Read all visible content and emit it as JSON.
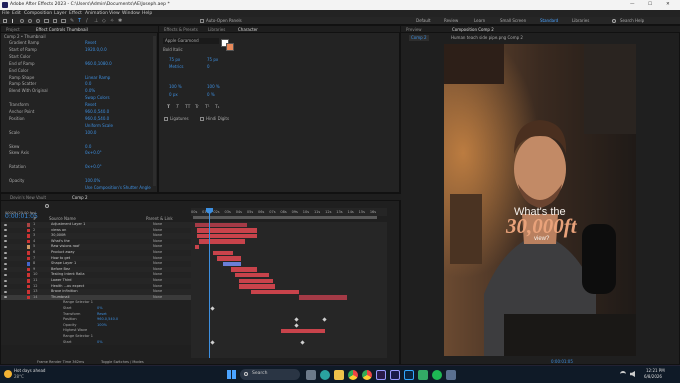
{
  "window": {
    "title": "Adobe After Effects 2023 - C:\\Users\\Admin\\Documents\\AE\\Joseph.aep *",
    "minimize": "—",
    "maximize": "☐",
    "close": "✕"
  },
  "menu": [
    "File",
    "Edit",
    "Composition",
    "Layer",
    "Effect",
    "Animation",
    "View",
    "Window",
    "Help"
  ],
  "toolbar": {
    "snapping": "Auto-Open Panels",
    "workspaces": [
      "Default",
      "Review",
      "Learn",
      "Small Screen",
      "Standard",
      "Libraries"
    ],
    "active_workspace": "Standard",
    "search": "Search Help"
  },
  "effect_controls": {
    "tabs": [
      "Project",
      "Effect Controls  Thumbnail"
    ],
    "header": "Comp 2 • Thumbnail",
    "rows": [
      {
        "name": "Gradient Ramp",
        "value": "Reset"
      },
      {
        "name": "Start of Ramp",
        "value": "1920.0,0.0"
      },
      {
        "name": "Start Color",
        "value": ""
      },
      {
        "name": "End of Ramp",
        "value": "960.0,1080.0"
      },
      {
        "name": "End Color",
        "value": ""
      },
      {
        "name": "Ramp Shape",
        "value": "Linear Ramp"
      },
      {
        "name": "Ramp Scatter",
        "value": "0.0"
      },
      {
        "name": "Blend With Original",
        "value": "0.0%"
      },
      {
        "name": "",
        "value": "Swap Colors"
      },
      {
        "name": "Transform",
        "value": "Reset"
      },
      {
        "name": "Anchor Point",
        "value": "960.0,540.0"
      },
      {
        "name": "Position",
        "value": "960.0,540.0"
      },
      {
        "name": "",
        "value": "Uniform Scale"
      },
      {
        "name": "Scale",
        "value": "100.0"
      },
      {
        "name": "",
        "value": ""
      },
      {
        "name": "Skew",
        "value": "0.0"
      },
      {
        "name": "Skew Axis",
        "value": "0x+0.0°"
      },
      {
        "name": "",
        "value": ""
      },
      {
        "name": "Rotation",
        "value": "0x+0.0°"
      },
      {
        "name": "",
        "value": ""
      },
      {
        "name": "Opacity",
        "value": "100.0%"
      },
      {
        "name": "",
        "value": "Use Composition's Shutter Angle"
      }
    ]
  },
  "character": {
    "tabs": [
      "Effects & Presets",
      "Libraries",
      "Character"
    ],
    "font": "Apple Garamond",
    "style": "Bold Italic",
    "size": "75 px",
    "leading": "75 px",
    "tracking": "0",
    "kerning": "Metrics",
    "vscale": "100 %",
    "hscale": "100 %",
    "baseline": "0 px",
    "tsume": "0 %",
    "ligatures": "Ligatures",
    "hindi": "Hindi Digits",
    "style_buttons": [
      "T",
      "T",
      "TT",
      "Tr",
      "T¹",
      "T₁"
    ]
  },
  "composition": {
    "tabs": [
      "Preview",
      "Composition  Comp 2"
    ],
    "subtab": "Comp 2",
    "layer_label": "Human teach side pipe.png  Comp 2",
    "overlay_line1": "What's the",
    "overlay_line2": "30,000ft",
    "overlay_line3": "view?",
    "zoom": "50%",
    "resolution": "Half",
    "timecode": "0:00:01:05"
  },
  "timeline": {
    "tabs": [
      "Devin's New Vault",
      "Comp 2"
    ],
    "timecode": "0:00:01:05",
    "fps": "00029 (25.00 fps)",
    "columns": [
      "#",
      "Source Name",
      "Parent & Link"
    ],
    "ruler": [
      "00s",
      "01s",
      "02s",
      "03s",
      "04s",
      "05s",
      "06s",
      "07s",
      "08s",
      "09s",
      "10s",
      "11s",
      "12s",
      "13s",
      "14s",
      "15s",
      "16s"
    ],
    "layers": [
      {
        "num": "1",
        "name": "Adjustment Layer 1",
        "parent": "None",
        "color": "#a44"
      },
      {
        "num": "2",
        "name": "views on",
        "parent": "None",
        "color": "#c33"
      },
      {
        "num": "3",
        "name": "30,000ft",
        "parent": "None",
        "color": "#c33"
      },
      {
        "num": "4",
        "name": "What's the",
        "parent": "None",
        "color": "#c33"
      },
      {
        "num": "5",
        "name": "Raw visions roof",
        "parent": "None",
        "color": "#c96"
      },
      {
        "num": "6",
        "name": "Product away",
        "parent": "None",
        "color": "#c33"
      },
      {
        "num": "7",
        "name": "How to get",
        "parent": "None",
        "color": "#c33"
      },
      {
        "num": "8",
        "name": "Shape Layer 1",
        "parent": "None",
        "color": "#46c"
      },
      {
        "num": "9",
        "name": "Before Bez",
        "parent": "None",
        "color": "#c33"
      },
      {
        "num": "10",
        "name": "Testing Intent Ralla",
        "parent": "None",
        "color": "#c33"
      },
      {
        "num": "11",
        "name": "Lower Third",
        "parent": "None",
        "color": "#c33"
      },
      {
        "num": "12",
        "name": "Health ...ou expect",
        "parent": "None",
        "color": "#c33"
      },
      {
        "num": "13",
        "name": "Brave infinition",
        "parent": "None",
        "color": "#c33"
      },
      {
        "num": "14",
        "name": "Thumbnail",
        "parent": "None",
        "color": "#c33"
      }
    ],
    "sublayers": [
      {
        "name": "Range Selector 1",
        "value": ""
      },
      {
        "name": "Start",
        "value": "0%"
      },
      {
        "name": "Transform",
        "value": "Reset"
      },
      {
        "name": "Position",
        "value": "960.0,540.0"
      },
      {
        "name": "Opacity",
        "value": "100%"
      },
      {
        "name": "Highest Wave",
        "value": ""
      },
      {
        "name": "Range Selector 1",
        "value": ""
      },
      {
        "name": "Start",
        "value": "0%"
      }
    ],
    "footer_left": "Frame Render Time  362ms",
    "footer_right": "Toggle Switches / Modes"
  },
  "taskbar": {
    "weather_temp": "Hot days ahead",
    "weather_sub": "28°C",
    "search": "Search",
    "time": "12:21 PM",
    "date": "6/8/2026"
  }
}
